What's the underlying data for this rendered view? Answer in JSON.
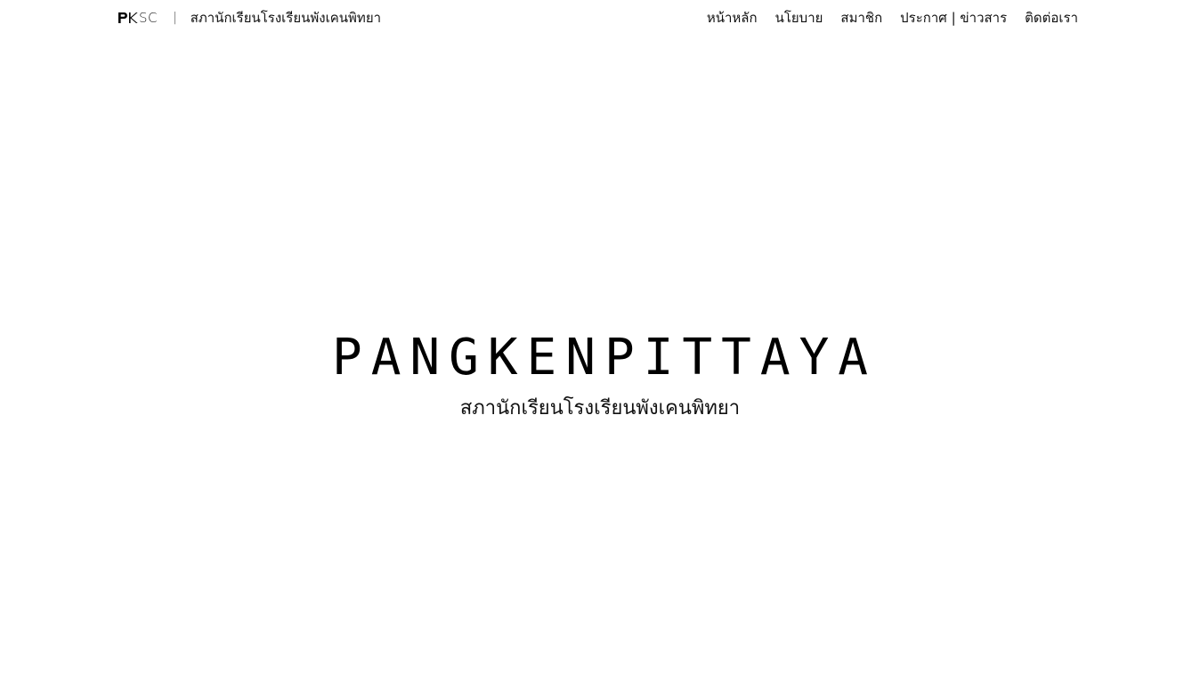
{
  "header": {
    "logo": {
      "mark": "PK",
      "suffix": "SC"
    },
    "separator": "|",
    "site_name": "สภานักเรียนโรงเรียนพังเคนพิทยา"
  },
  "nav": {
    "items": [
      {
        "label": "หน้าหลัก"
      },
      {
        "label": "นโยบาย"
      },
      {
        "label": "สมาชิก"
      },
      {
        "label": "ประกาศ | ข่าวสาร"
      },
      {
        "label": "ติดต่อเรา"
      }
    ]
  },
  "hero": {
    "title": "PANGKENPITTAYA",
    "subtitle": "สภานักเรียนโรงเรียนพังเคนพิทยา"
  }
}
